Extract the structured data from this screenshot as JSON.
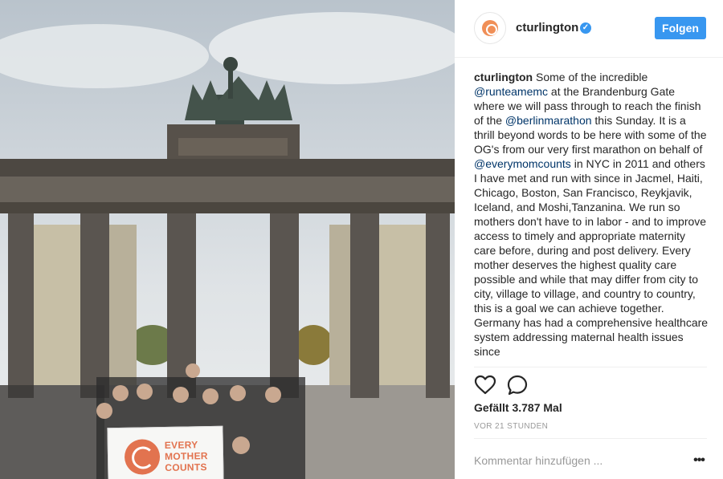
{
  "post": {
    "username": "cturlington",
    "verified_glyph": "✓",
    "follow_label": "Folgen",
    "caption": {
      "username": "cturlington",
      "parts": [
        " Some of the incredible ",
        "@runteamemc",
        " at the Brandenburg Gate where we will pass through to reach the finish of the ",
        "@berlinmarathon",
        " this Sunday. It is a thrill beyond words to be here with some of the OG's from our very first marathon on behalf of ",
        "@everymomcounts",
        " in NYC in 2011 and others I have met and run with since in Jacmel, Haiti, Chicago, Boston, San Francisco, Reykjavik, Iceland, and Moshi,Tanzanina. We run so mothers don't have to in labor - and to improve access to timely and appropriate maternity care before, during and post delivery. Every mother deserves the highest quality care possible and while that may differ from city to city, village to village, and country to country, this is a goal we can achieve together. Germany has had a comprehensive healthcare system addressing maternal health issues since"
      ]
    },
    "likes_text": "Gefällt 3.787 Mal",
    "timestamp": "VOR 21 STUNDEN",
    "comment_placeholder": "Kommentar hinzufügen ...",
    "more_label": "•••",
    "banner_text": "EVERY MOTHER COUNTS"
  },
  "icons": {
    "like": "heart-icon",
    "comment": "comment-icon",
    "verified": "verified-badge-icon",
    "more": "more-options-icon"
  },
  "colors": {
    "accent": "#3897f0",
    "link": "#003569",
    "brand": "#e2734f"
  }
}
